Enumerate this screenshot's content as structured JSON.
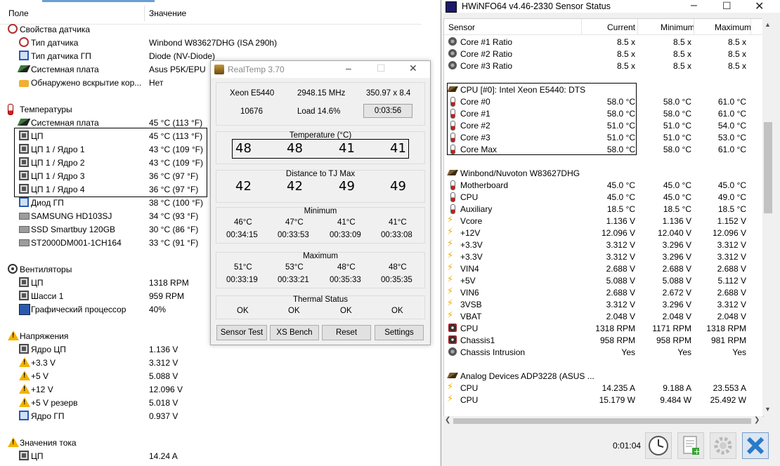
{
  "aida": {
    "col_field": "Поле",
    "col_value": "Значение",
    "rows": [
      {
        "label": "Свойства датчика",
        "value": "",
        "icon": "gauge-icon",
        "section": true
      },
      {
        "label": "Тип датчика",
        "value": "Winbond W83627DHG  (ISA 290h)",
        "icon": "gauge-icon"
      },
      {
        "label": "Тип датчика ГП",
        "value": "Diode  (NV-Diode)",
        "icon": "monitor-icon"
      },
      {
        "label": "Системная плата",
        "value": "Asus P5K/EPU",
        "icon": "motherboard-icon"
      },
      {
        "label": "Обнаружено вскрытие кор...",
        "value": "Нет",
        "icon": "lock-icon"
      },
      {
        "label": "",
        "value": "",
        "icon": "",
        "section": false,
        "blank": true
      },
      {
        "label": "Температуры",
        "value": "",
        "icon": "thermometer-icon",
        "section": true
      },
      {
        "label": "Системная плата",
        "value": "45 °C  (113 °F)",
        "icon": "motherboard-icon"
      },
      {
        "label": "ЦП",
        "value": "45 °C  (113 °F)",
        "icon": "cpu-icon"
      },
      {
        "label": "ЦП 1 / Ядро 1",
        "value": "43 °C  (109 °F)",
        "icon": "cpu-icon"
      },
      {
        "label": "ЦП 1 / Ядро 2",
        "value": "43 °C  (109 °F)",
        "icon": "cpu-icon"
      },
      {
        "label": "ЦП 1 / Ядро 3",
        "value": "36 °C  (97 °F)",
        "icon": "cpu-icon"
      },
      {
        "label": "ЦП 1 / Ядро 4",
        "value": "36 °C  (97 °F)",
        "icon": "cpu-icon"
      },
      {
        "label": "Диод ГП",
        "value": "38 °C  (100 °F)",
        "icon": "monitor-icon"
      },
      {
        "label": "SAMSUNG HD103SJ",
        "value": "34 °C  (93 °F)",
        "icon": "hdd-icon"
      },
      {
        "label": "SSD Smartbuy 120GB",
        "value": "30 °C  (86 °F)",
        "icon": "hdd-icon"
      },
      {
        "label": "ST2000DM001-1CH164",
        "value": "33 °C  (91 °F)",
        "icon": "hdd-icon"
      },
      {
        "label": "",
        "value": "",
        "icon": "",
        "blank": true
      },
      {
        "label": "Вентиляторы",
        "value": "",
        "icon": "fan-icon",
        "section": true
      },
      {
        "label": "ЦП",
        "value": "1318 RPM",
        "icon": "cpu-icon"
      },
      {
        "label": "Шасси 1",
        "value": "959 RPM",
        "icon": "cpu-icon"
      },
      {
        "label": "Графический процессор",
        "value": "40%",
        "icon": "gpu-icon"
      },
      {
        "label": "",
        "value": "",
        "icon": "",
        "blank": true
      },
      {
        "label": "Напряжения",
        "value": "",
        "icon": "warning-icon",
        "section": true
      },
      {
        "label": "Ядро ЦП",
        "value": "1.136 V",
        "icon": "cpu-icon"
      },
      {
        "label": "+3.3 V",
        "value": "3.312 V",
        "icon": "warning-icon"
      },
      {
        "label": "+5 V",
        "value": "5.088 V",
        "icon": "warning-icon"
      },
      {
        "label": "+12 V",
        "value": "12.096 V",
        "icon": "warning-icon"
      },
      {
        "label": "+5 V резерв",
        "value": "5.018 V",
        "icon": "warning-icon"
      },
      {
        "label": "Ядро ГП",
        "value": "0.937 V",
        "icon": "monitor-icon"
      },
      {
        "label": "",
        "value": "",
        "icon": "",
        "blank": true
      },
      {
        "label": "Значения тока",
        "value": "",
        "icon": "warning-icon",
        "section": true
      },
      {
        "label": "ЦП",
        "value": "14.24 A",
        "icon": "cpu-icon"
      }
    ]
  },
  "realtemp": {
    "title": "RealTemp 3.70",
    "cpu_model": "Xeon E5440",
    "mhz": "2948.15 MHz",
    "bus": "350.97 x 8.4",
    "vid": "10676",
    "load": "Load  14.6%",
    "timer": "0:03:56",
    "temp_title": "Temperature (°C)",
    "temps": [
      "48",
      "48",
      "41",
      "41"
    ],
    "dist_title": "Distance to TJ Max",
    "dists": [
      "42",
      "42",
      "49",
      "49"
    ],
    "min_title": "Minimum",
    "min_temps": [
      "46°C",
      "47°C",
      "41°C",
      "41°C"
    ],
    "min_times": [
      "00:34:15",
      "00:33:53",
      "00:33:09",
      "00:33:08"
    ],
    "max_title": "Maximum",
    "max_temps": [
      "51°C",
      "53°C",
      "48°C",
      "48°C"
    ],
    "max_times": [
      "00:33:19",
      "00:33:21",
      "00:35:33",
      "00:35:35"
    ],
    "thermal_title": "Thermal Status",
    "thermal": [
      "OK",
      "OK",
      "OK",
      "OK"
    ],
    "buttons": [
      "Sensor Test",
      "XS Bench",
      "Reset",
      "Settings"
    ]
  },
  "hwinfo": {
    "title": "HWiNFO64 v4.46-2330 Sensor Status",
    "cols": [
      "Sensor",
      "Current",
      "Minimum",
      "Maximum"
    ],
    "rows": [
      {
        "n": "Core #1 Ratio",
        "c": "8.5 x",
        "mn": "8.5 x",
        "mx": "8.5 x",
        "icon": "disk-icon"
      },
      {
        "n": "Core #2 Ratio",
        "c": "8.5 x",
        "mn": "8.5 x",
        "mx": "8.5 x",
        "icon": "disk-icon"
      },
      {
        "n": "Core #3 Ratio",
        "c": "8.5 x",
        "mn": "8.5 x",
        "mx": "8.5 x",
        "icon": "disk-icon"
      },
      {
        "blank": true
      },
      {
        "n": "CPU [#0]: Intel Xeon E5440: DTS",
        "icon": "chip-icon",
        "group": true
      },
      {
        "n": "Core #0",
        "c": "58.0 °C",
        "mn": "58.0 °C",
        "mx": "61.0 °C",
        "icon": "thermometer-icon"
      },
      {
        "n": "Core #1",
        "c": "58.0 °C",
        "mn": "58.0 °C",
        "mx": "61.0 °C",
        "icon": "thermometer-icon"
      },
      {
        "n": "Core #2",
        "c": "51.0 °C",
        "mn": "51.0 °C",
        "mx": "54.0 °C",
        "icon": "thermometer-icon"
      },
      {
        "n": "Core #3",
        "c": "51.0 °C",
        "mn": "51.0 °C",
        "mx": "53.0 °C",
        "icon": "thermometer-icon"
      },
      {
        "n": "Core Max",
        "c": "58.0 °C",
        "mn": "58.0 °C",
        "mx": "61.0 °C",
        "icon": "thermometer-icon"
      },
      {
        "blank": true
      },
      {
        "n": "Winbond/Nuvoton W83627DHG",
        "icon": "chip-icon",
        "group": true
      },
      {
        "n": "Motherboard",
        "c": "45.0 °C",
        "mn": "45.0 °C",
        "mx": "45.0 °C",
        "icon": "thermometer-icon"
      },
      {
        "n": "CPU",
        "c": "45.0 °C",
        "mn": "45.0 °C",
        "mx": "49.0 °C",
        "icon": "thermometer-icon"
      },
      {
        "n": "Auxiliary",
        "c": "18.5 °C",
        "mn": "18.5 °C",
        "mx": "18.5 °C",
        "icon": "thermometer-icon"
      },
      {
        "n": "Vcore",
        "c": "1.136 V",
        "mn": "1.136 V",
        "mx": "1.152 V",
        "icon": "voltage-icon"
      },
      {
        "n": "+12V",
        "c": "12.096 V",
        "mn": "12.040 V",
        "mx": "12.096 V",
        "icon": "voltage-icon"
      },
      {
        "n": "+3.3V",
        "c": "3.312 V",
        "mn": "3.296 V",
        "mx": "3.312 V",
        "icon": "voltage-icon"
      },
      {
        "n": "+3.3V",
        "c": "3.312 V",
        "mn": "3.296 V",
        "mx": "3.312 V",
        "icon": "voltage-icon"
      },
      {
        "n": "VIN4",
        "c": "2.688 V",
        "mn": "2.688 V",
        "mx": "2.688 V",
        "icon": "voltage-icon"
      },
      {
        "n": "+5V",
        "c": "5.088 V",
        "mn": "5.088 V",
        "mx": "5.112 V",
        "icon": "voltage-icon"
      },
      {
        "n": "VIN6",
        "c": "2.688 V",
        "mn": "2.672 V",
        "mx": "2.688 V",
        "icon": "voltage-icon"
      },
      {
        "n": "3VSB",
        "c": "3.312 V",
        "mn": "3.296 V",
        "mx": "3.312 V",
        "icon": "voltage-icon"
      },
      {
        "n": "VBAT",
        "c": "2.048 V",
        "mn": "2.048 V",
        "mx": "2.048 V",
        "icon": "voltage-icon"
      },
      {
        "n": "CPU",
        "c": "1318 RPM",
        "mn": "1171 RPM",
        "mx": "1318 RPM",
        "icon": "fan-icon"
      },
      {
        "n": "Chassis1",
        "c": "958 RPM",
        "mn": "958 RPM",
        "mx": "981 RPM",
        "icon": "fan-icon"
      },
      {
        "n": "Chassis Intrusion",
        "c": "Yes",
        "mn": "Yes",
        "mx": "Yes",
        "icon": "disk-icon"
      },
      {
        "blank": true
      },
      {
        "n": "Analog Devices ADP3228 (ASUS ...",
        "icon": "chip-icon",
        "group": true
      },
      {
        "n": "CPU",
        "c": "14.235 A",
        "mn": "9.188 A",
        "mx": "23.553 A",
        "icon": "voltage-icon"
      },
      {
        "n": "CPU",
        "c": "15.179 W",
        "mn": "9.484 W",
        "mx": "25.492 W",
        "icon": "voltage-icon"
      }
    ],
    "elapsed": "0:01:04"
  }
}
